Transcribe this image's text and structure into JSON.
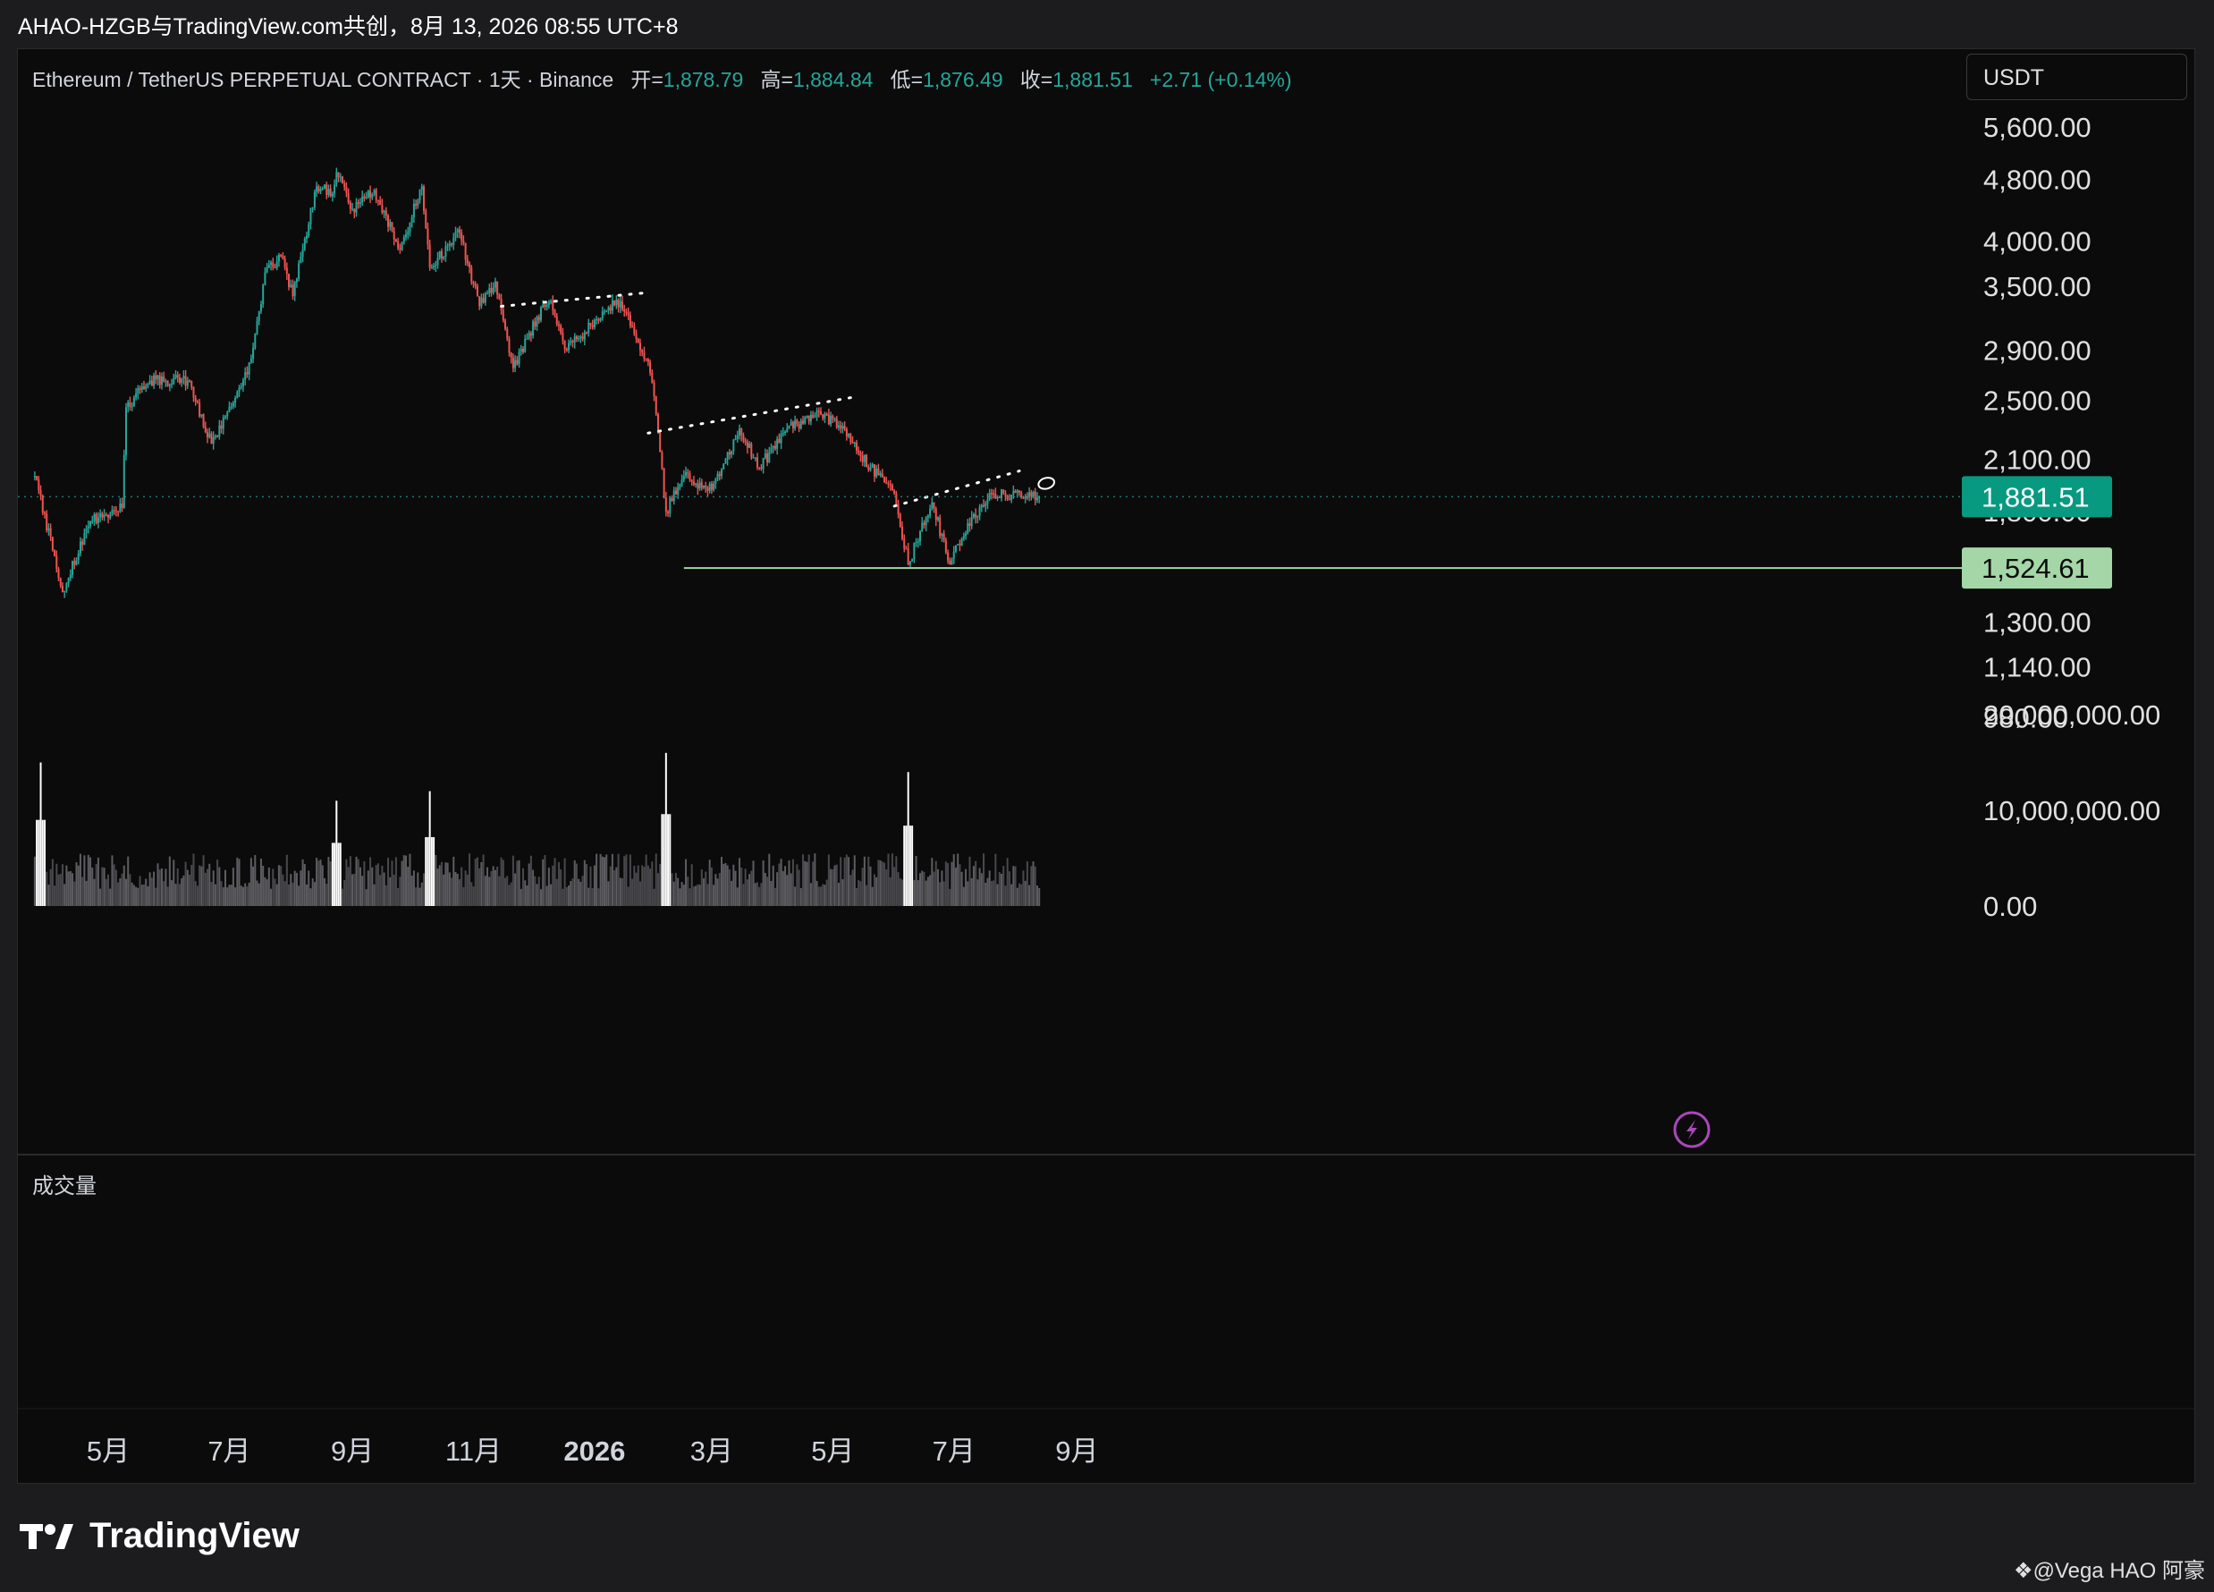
{
  "header": {
    "caption": "AHAO-HZGB与TradingView.com共创，8月 13, 2026 08:55 UTC+8"
  },
  "legend": {
    "symbol": "Ethereum / TetherUS PERPETUAL CONTRACT · 1天 · Binance",
    "open_label": "开=",
    "open": "1,878.79",
    "high_label": "高=",
    "high": "1,884.84",
    "low_label": "低=",
    "low": "1,876.49",
    "close_label": "收=",
    "close": "1,881.51",
    "change": "+2.71 (+0.14%)"
  },
  "currency": "USDT",
  "volume_title": "成交量",
  "brand": "TradingView",
  "watermark": "@Vega HAO 阿豪",
  "colors": {
    "up": "#26a69a",
    "down": "#ef5350",
    "background": "#0b0b0b",
    "last_price_tag": "#089981",
    "support_tag": "#a5d6a7",
    "support_line": "#a5d6a7"
  },
  "chart_data": {
    "type": "candlestick",
    "scale": "log",
    "price_axis_ticks": [
      "5,600.00",
      "4,800.00",
      "4,000.00",
      "3,500.00",
      "2,900.00",
      "2,500.00",
      "2,100.00",
      "1,800.00",
      "1,300.00",
      "1,140.00",
      "980.00"
    ],
    "volume_axis_ticks": [
      "20,000,000.00",
      "10,000,000.00",
      "0.00"
    ],
    "time_axis_labels": [
      "5月",
      "7月",
      "9月",
      "11月",
      "2026",
      "3月",
      "5月",
      "7月",
      "9月"
    ],
    "last_price": "1,881.51",
    "support_level": "1,524.61",
    "price_path": [
      {
        "date": "2025-03-25",
        "price": 2000
      },
      {
        "date": "2025-04-08",
        "price": 1420
      },
      {
        "date": "2025-04-22",
        "price": 1750
      },
      {
        "date": "2025-05-08",
        "price": 1820
      },
      {
        "date": "2025-05-10",
        "price": 2450
      },
      {
        "date": "2025-05-22",
        "price": 2650
      },
      {
        "date": "2025-06-10",
        "price": 2650
      },
      {
        "date": "2025-06-22",
        "price": 2200
      },
      {
        "date": "2025-07-01",
        "price": 2450
      },
      {
        "date": "2025-07-10",
        "price": 2700
      },
      {
        "date": "2025-07-20",
        "price": 3700
      },
      {
        "date": "2025-07-28",
        "price": 3800
      },
      {
        "date": "2025-08-02",
        "price": 3400
      },
      {
        "date": "2025-08-14",
        "price": 4700
      },
      {
        "date": "2025-08-22",
        "price": 4600
      },
      {
        "date": "2025-08-24",
        "price": 4900
      },
      {
        "date": "2025-09-01",
        "price": 4400
      },
      {
        "date": "2025-09-12",
        "price": 4650
      },
      {
        "date": "2025-09-25",
        "price": 3900
      },
      {
        "date": "2025-10-06",
        "price": 4700
      },
      {
        "date": "2025-10-10",
        "price": 3700
      },
      {
        "date": "2025-10-25",
        "price": 4100
      },
      {
        "date": "2025-11-04",
        "price": 3300
      },
      {
        "date": "2025-11-12",
        "price": 3550
      },
      {
        "date": "2025-11-21",
        "price": 2750
      },
      {
        "date": "2025-12-03",
        "price": 3200
      },
      {
        "date": "2025-12-10",
        "price": 3350
      },
      {
        "date": "2025-12-18",
        "price": 2900
      },
      {
        "date": "2026-01-06",
        "price": 3250
      },
      {
        "date": "2026-01-14",
        "price": 3350
      },
      {
        "date": "2026-01-28",
        "price": 2800
      },
      {
        "date": "2026-02-01",
        "price": 2400
      },
      {
        "date": "2026-02-06",
        "price": 1800
      },
      {
        "date": "2026-02-15",
        "price": 2000
      },
      {
        "date": "2026-03-01",
        "price": 1920
      },
      {
        "date": "2026-03-08",
        "price": 2100
      },
      {
        "date": "2026-03-15",
        "price": 2300
      },
      {
        "date": "2026-03-25",
        "price": 2050
      },
      {
        "date": "2026-04-08",
        "price": 2300
      },
      {
        "date": "2026-04-25",
        "price": 2400
      },
      {
        "date": "2026-05-05",
        "price": 2300
      },
      {
        "date": "2026-05-20",
        "price": 2050
      },
      {
        "date": "2026-06-01",
        "price": 1900
      },
      {
        "date": "2026-06-08",
        "price": 1540
      },
      {
        "date": "2026-06-14",
        "price": 1700
      },
      {
        "date": "2026-06-20",
        "price": 1850
      },
      {
        "date": "2026-06-29",
        "price": 1540
      },
      {
        "date": "2026-07-08",
        "price": 1740
      },
      {
        "date": "2026-07-20",
        "price": 1900
      },
      {
        "date": "2026-08-13",
        "price": 1881.51
      }
    ],
    "volume_spikes": [
      {
        "date": "2025-03-28",
        "volume": 15000000
      },
      {
        "date": "2025-08-24",
        "volume": 11000000
      },
      {
        "date": "2025-10-10",
        "volume": 12000000
      },
      {
        "date": "2026-02-06",
        "volume": 16000000
      },
      {
        "date": "2026-06-08",
        "volume": 14000000
      }
    ],
    "volume_typical": 5000000,
    "trendlines": [
      {
        "style": "dotted",
        "from": {
          "date": "2025-11-15",
          "price": 3300
        },
        "to": {
          "date": "2026-01-25",
          "price": 3430
        }
      },
      {
        "style": "dotted",
        "from": {
          "date": "2026-01-28",
          "price": 2270
        },
        "to": {
          "date": "2026-05-10",
          "price": 2520
        }
      },
      {
        "style": "dotted",
        "from": {
          "date": "2026-06-01",
          "price": 1830
        },
        "to": {
          "date": "2026-08-03",
          "price": 2030
        }
      }
    ],
    "support": {
      "price": 1524.61,
      "from_date": "2026-02-15"
    }
  }
}
